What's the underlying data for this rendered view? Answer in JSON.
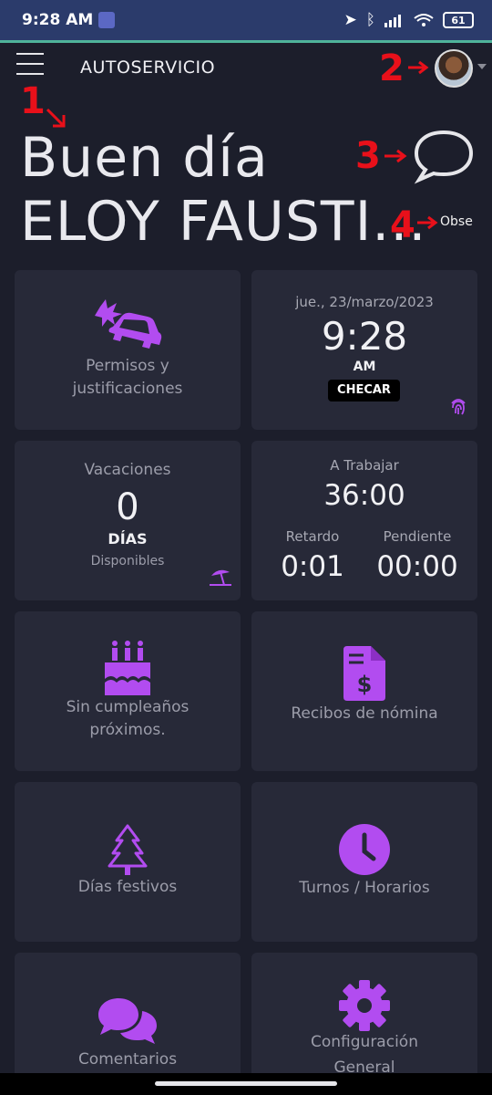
{
  "status_bar": {
    "time": "9:28 AM",
    "battery": "61"
  },
  "app": {
    "title": "AUTOSERVICIO"
  },
  "annotations": {
    "a1": "1",
    "a2": "2",
    "a3": "3",
    "a4": "4"
  },
  "greeting": {
    "line1": "Buen día",
    "name": "ELOY FAUSTI...",
    "obs": "Obse"
  },
  "cards": {
    "permisos": {
      "label1": "Permisos y",
      "label2": "justificaciones"
    },
    "clock": {
      "date": "jue., 23/marzo/2023",
      "time": "9:28",
      "ampm": "AM",
      "button": "CHECAR"
    },
    "vacaciones": {
      "title": "Vacaciones",
      "count": "0",
      "unit": "DÍAS",
      "sub": "Disponibles"
    },
    "trabajo": {
      "title": "A Trabajar",
      "hours": "36:00",
      "retardo_label": "Retardo",
      "retardo": "0:01",
      "pendiente_label": "Pendiente",
      "pendiente": "00:00"
    },
    "cumple": {
      "label1": "Sin cumpleaños",
      "label2": "próximos."
    },
    "recibos": {
      "label": "Recibos de nómina"
    },
    "festivos": {
      "label": "Días festivos"
    },
    "turnos": {
      "label": "Turnos / Horarios"
    },
    "comentarios": {
      "label": "Comentarios"
    },
    "config": {
      "label1": "Configuración",
      "label2": "General"
    }
  },
  "colors": {
    "accent": "#b24cf0",
    "card": "#272938",
    "background": "#1c1e2b",
    "statusbar": "#2b3b6b"
  }
}
